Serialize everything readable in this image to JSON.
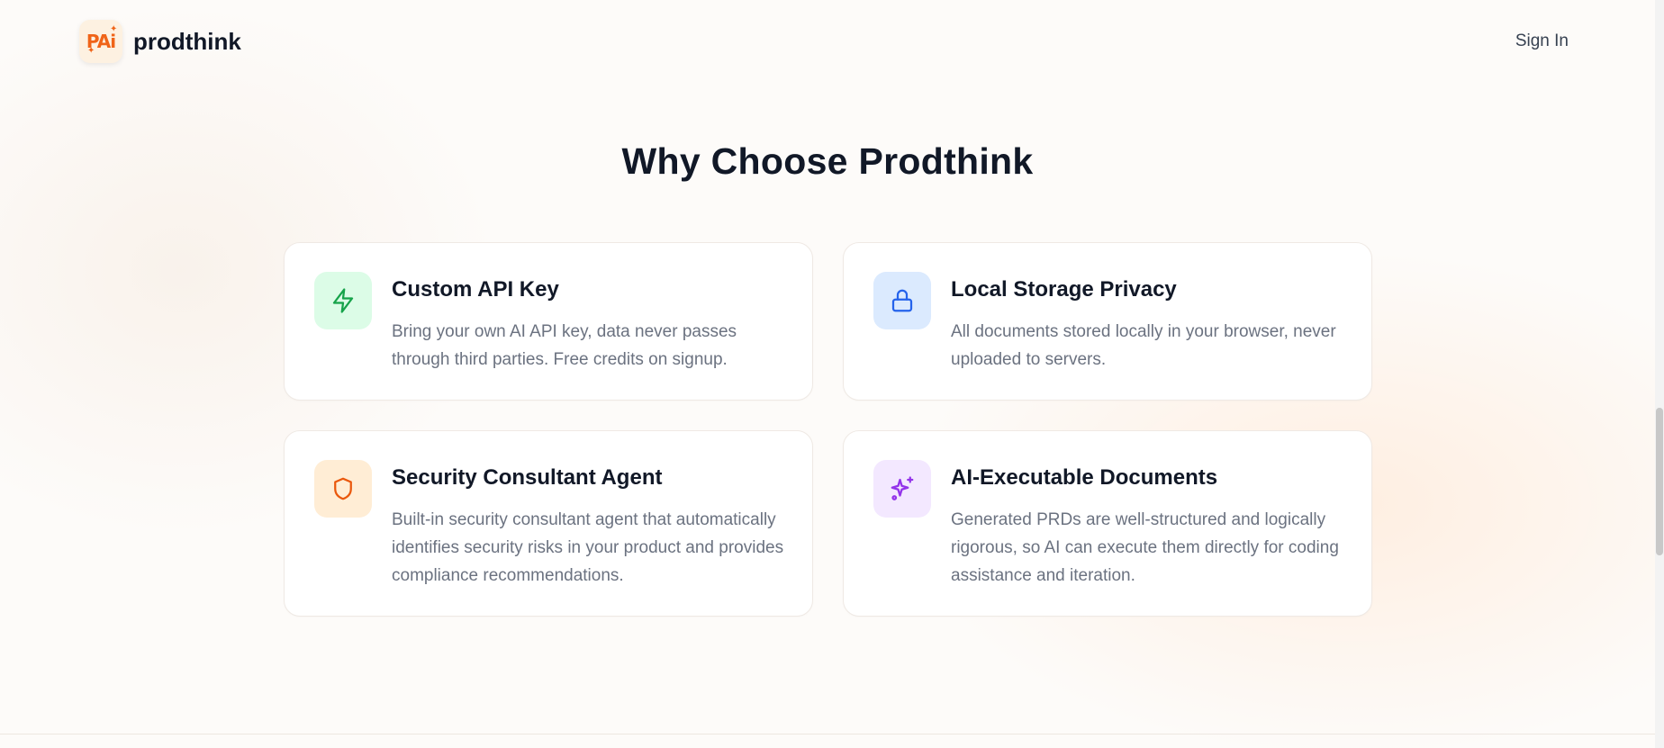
{
  "header": {
    "logo_text": "PAi",
    "brand_name": "prodthink",
    "sign_in_label": "Sign In"
  },
  "section": {
    "title": "Why Choose Prodthink"
  },
  "features": [
    {
      "icon": "lightning-bolt-icon",
      "icon_color": "#16a34a",
      "icon_bg": "#dcfce7",
      "title": "Custom API Key",
      "description": "Bring your own AI API key, data never passes through third parties. Free credits on signup."
    },
    {
      "icon": "lock-icon",
      "icon_color": "#2563eb",
      "icon_bg": "#dbeafe",
      "title": "Local Storage Privacy",
      "description": "All documents stored locally in your browser, never uploaded to servers."
    },
    {
      "icon": "shield-icon",
      "icon_color": "#ea580c",
      "icon_bg": "#ffedd5",
      "title": "Security Consultant Agent",
      "description": "Built-in security consultant agent that automatically identifies security risks in your product and provides compliance recommendations."
    },
    {
      "icon": "sparkles-icon",
      "icon_color": "#9333ea",
      "icon_bg": "#f3e8ff",
      "title": "AI-Executable Documents",
      "description": "Generated PRDs are well-structured and logically rigorous, so AI can execute them directly for coding assistance and iteration."
    }
  ],
  "colors": {
    "accent": "#f06418",
    "text_primary": "#111827",
    "text_secondary": "#6b7280"
  }
}
